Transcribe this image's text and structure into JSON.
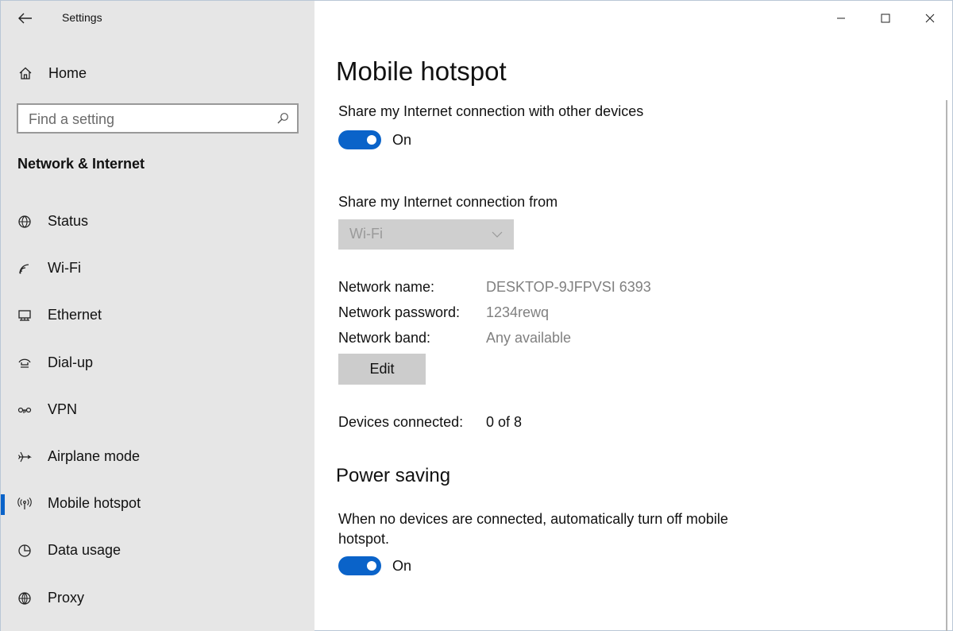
{
  "window": {
    "title": "Settings"
  },
  "sidebar": {
    "home_label": "Home",
    "search_placeholder": "Find a setting",
    "section_label": "Network & Internet",
    "items": [
      {
        "label": "Status",
        "icon": "globe-status-icon"
      },
      {
        "label": "Wi-Fi",
        "icon": "wifi-icon"
      },
      {
        "label": "Ethernet",
        "icon": "ethernet-icon"
      },
      {
        "label": "Dial-up",
        "icon": "dialup-icon"
      },
      {
        "label": "VPN",
        "icon": "vpn-icon"
      },
      {
        "label": "Airplane mode",
        "icon": "airplane-icon"
      },
      {
        "label": "Mobile hotspot",
        "icon": "hotspot-icon",
        "active": true
      },
      {
        "label": "Data usage",
        "icon": "data-usage-icon"
      },
      {
        "label": "Proxy",
        "icon": "proxy-globe-icon"
      }
    ]
  },
  "main": {
    "title": "Mobile hotspot",
    "share_label": "Share my Internet connection with other devices",
    "share_toggle": {
      "state": "On",
      "on": true
    },
    "from_label": "Share my Internet connection from",
    "from_dropdown": {
      "value": "Wi-Fi"
    },
    "network_name_label": "Network name:",
    "network_name_value": "DESKTOP-9JFPVSI 6393",
    "network_password_label": "Network password:",
    "network_password_value": "1234rewq",
    "network_band_label": "Network band:",
    "network_band_value": "Any available",
    "edit_label": "Edit",
    "devices_label": "Devices connected:",
    "devices_value": "0 of 8",
    "power_title": "Power saving",
    "power_desc": "When no devices are connected, automatically turn off mobile hotspot.",
    "power_toggle": {
      "state": "On",
      "on": true
    }
  },
  "colors": {
    "accent": "#0a63c9",
    "sidebar_bg": "#e6e6e6",
    "disabled_bg": "#cfcfcf"
  }
}
